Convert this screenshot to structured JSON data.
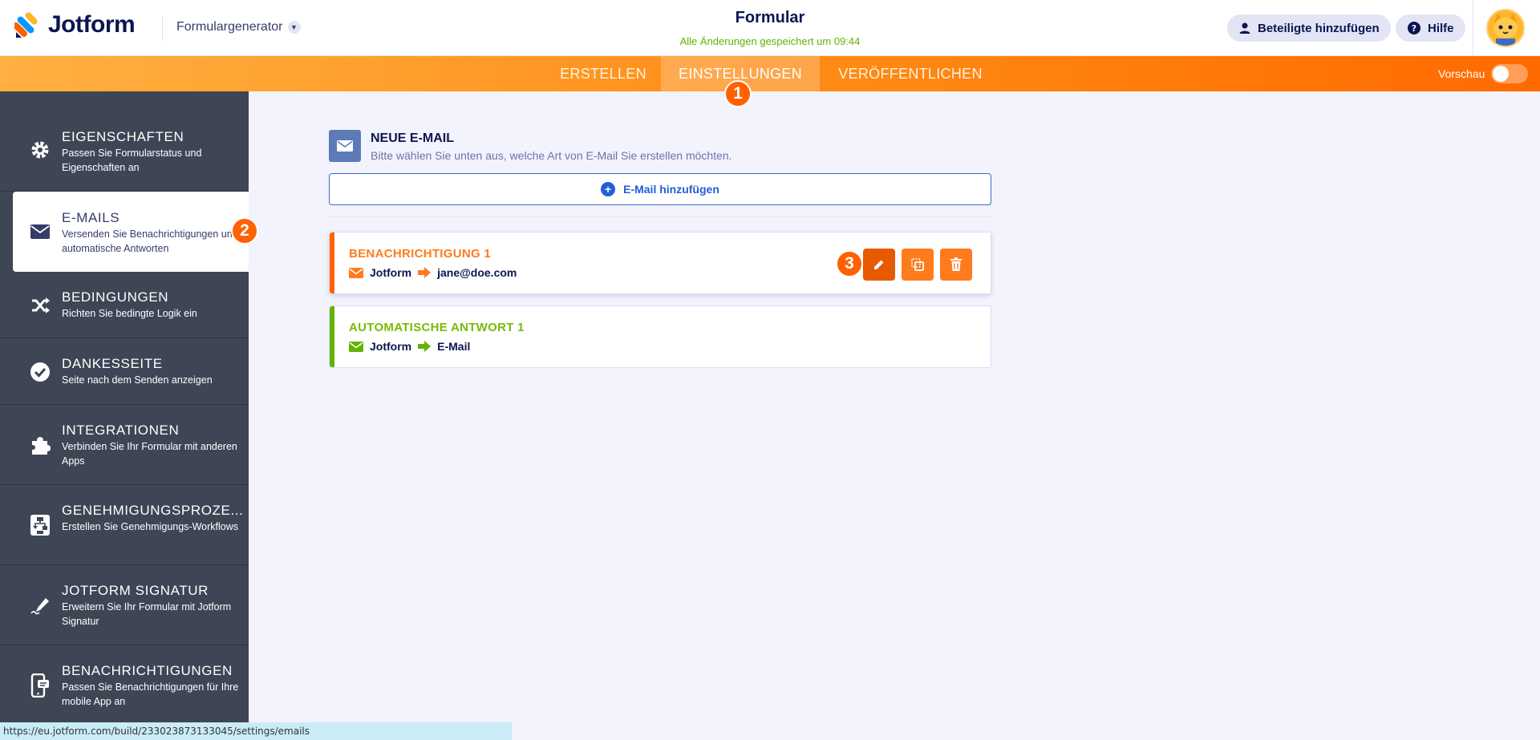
{
  "header": {
    "logo_text": "Jotform",
    "form_builder_label": "Formulargenerator",
    "form_title": "Formular",
    "save_status": "Alle Änderungen gespeichert um 09:44",
    "add_participants_label": "Beteiligte hinzufügen",
    "help_label": "Hilfe"
  },
  "nav": {
    "tabs": [
      {
        "label": "ERSTELLEN"
      },
      {
        "label": "EINSTELLUNGEN"
      },
      {
        "label": "VERÖFFENTLICHEN"
      }
    ],
    "preview_label": "Vorschau"
  },
  "steps": [
    "1",
    "2",
    "3"
  ],
  "sidebar": {
    "items": [
      {
        "title": "EIGENSCHAFTEN",
        "desc": "Passen Sie Formularstatus und Eigenschaften an",
        "icon": "gear-icon"
      },
      {
        "title": "E-MAILS",
        "desc": "Versenden Sie Benachrichtigungen und automatische Antworten",
        "icon": "envelope-icon"
      },
      {
        "title": "BEDINGUNGEN",
        "desc": "Richten Sie bedingte Logik ein",
        "icon": "shuffle-icon"
      },
      {
        "title": "DANKESSEITE",
        "desc": "Seite nach dem Senden anzeigen",
        "icon": "check-circle-icon"
      },
      {
        "title": "INTEGRATIONEN",
        "desc": "Verbinden Sie Ihr Formular mit anderen Apps",
        "icon": "puzzle-icon"
      },
      {
        "title": "GENEHMIGUNGSPROZE...",
        "desc": "Erstellen Sie Genehmigungs-Workflows",
        "icon": "approval-flow-icon"
      },
      {
        "title": "JOTFORM SIGNATUR",
        "desc": "Erweitern Sie Ihr Formular mit Jotform Signatur",
        "icon": "signature-pen-icon"
      },
      {
        "title": "BENACHRICHTIGUNGEN",
        "desc": "Passen Sie Benachrichtigungen für Ihre mobile App an",
        "icon": "mobile-notification-icon"
      }
    ]
  },
  "main": {
    "new_email_title": "NEUE E-MAIL",
    "new_email_desc": "Bitte wählen Sie unten aus, welche Art von E-Mail Sie erstellen möchten.",
    "add_email_label": "E-Mail hinzufügen",
    "cards": [
      {
        "title": "BENACHRICHTIGUNG 1",
        "from": "Jotform",
        "to": "jane@doe.com"
      },
      {
        "title": "AUTOMATISCHE ANTWORT 1",
        "from": "Jotform",
        "to": "E-Mail"
      }
    ]
  },
  "status_url": "https://eu.jotform.com/build/233023873133045/settings/emails",
  "colors": {
    "accent_orange": "#ff6100",
    "nav_gradient_start": "#ffb041",
    "nav_gradient_end": "#ff6a00",
    "sidebar_bg": "#3e4554",
    "success_green": "#64b200",
    "link_blue": "#2260d4"
  }
}
